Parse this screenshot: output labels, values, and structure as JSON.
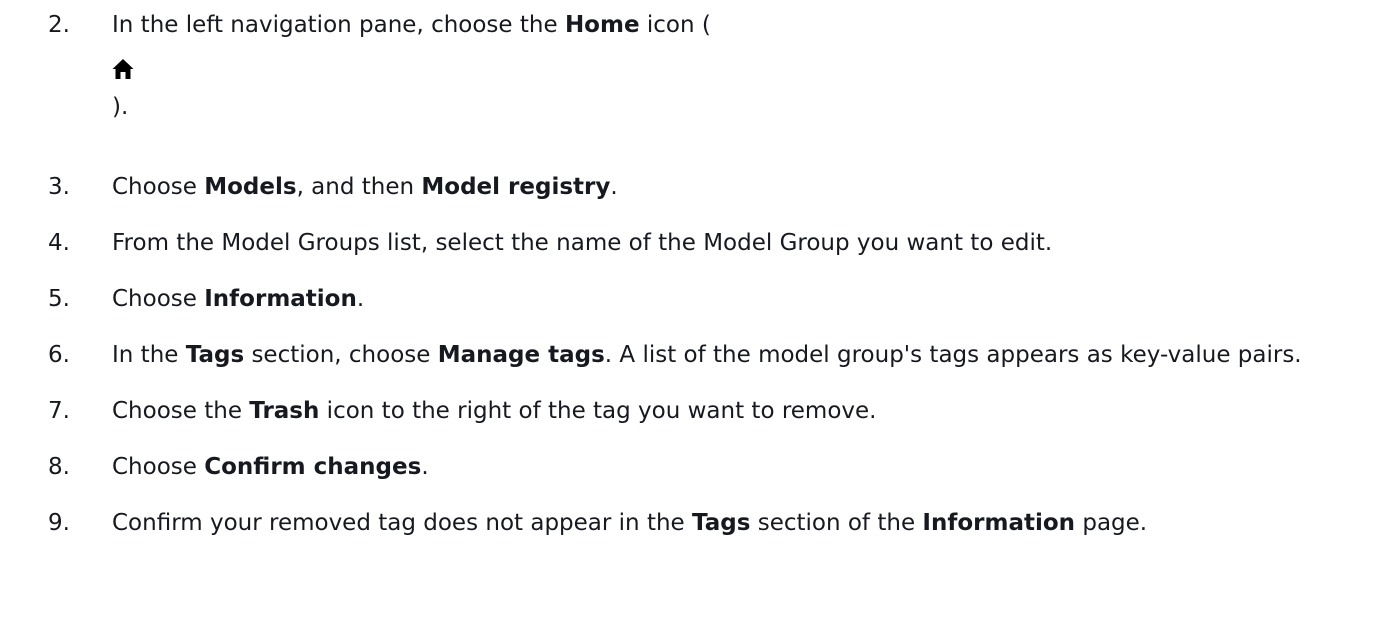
{
  "steps": [
    {
      "number": "2.",
      "line1_prefix": "In the left navigation pane, choose the ",
      "line1_bold": "Home",
      "line1_suffix": " icon (",
      "icon": "home-icon",
      "line3": ")."
    },
    {
      "number": "3.",
      "t1": "Choose ",
      "b1": "Models",
      "t2": ", and then ",
      "b2": "Model registry",
      "t3": "."
    },
    {
      "number": "4.",
      "t1": "From the Model Groups list, select the name of the Model Group you want to edit."
    },
    {
      "number": "5.",
      "t1": "Choose ",
      "b1": "Information",
      "t2": "."
    },
    {
      "number": "6.",
      "t1": "In the ",
      "b1": "Tags",
      "t2": " section, choose ",
      "b2": "Manage tags",
      "t3": ". A list of the model group's tags appears as key-value pairs."
    },
    {
      "number": "7.",
      "t1": "Choose the ",
      "b1": "Trash",
      "t2": " icon to the right of the tag you want to remove."
    },
    {
      "number": "8.",
      "t1": "Choose ",
      "b1": "Confirm changes",
      "t2": "."
    },
    {
      "number": "9.",
      "t1": "Confirm your removed tag does not appear in the ",
      "b1": "Tags",
      "t2": " section of the ",
      "b2": "Information",
      "t3": " page."
    }
  ]
}
